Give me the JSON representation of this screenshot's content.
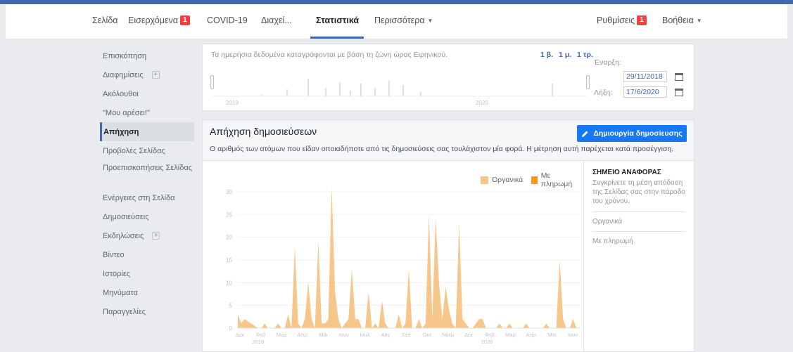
{
  "nav": {
    "page": "Σελίδα",
    "inbox": "Εισερχόμενα",
    "inbox_badge": "1",
    "covid": "COVID-19",
    "manage": "Διαχεί...",
    "insights": "Στατιστικά",
    "more": "Περισσότερα",
    "settings": "Ρυθμίσεις",
    "settings_badge": "1",
    "help": "Βοήθεια"
  },
  "sidebar": {
    "items": [
      {
        "label": "Επισκόπηση"
      },
      {
        "label": "Διαφημίσεις"
      },
      {
        "label": "Ακόλουθοι"
      },
      {
        "label": "\"Μου αρέσει!\""
      },
      {
        "label": "Απήχηση"
      },
      {
        "label": "Προβολές Σελίδας"
      },
      {
        "label": "Προεπισκοπήσεις Σελίδας"
      },
      {
        "label": "Ενέργειες στη Σελίδα"
      },
      {
        "label": "Δημοσιεύσεις"
      },
      {
        "label": "Εκδηλώσεις"
      },
      {
        "label": "Βίντεο"
      },
      {
        "label": "Ιστορίες"
      },
      {
        "label": "Μηνύματα"
      },
      {
        "label": "Παραγγελίες"
      }
    ]
  },
  "range": {
    "tz_note": "Τα ημερήσια δεδομένα καταγράφονται με βάση τη ζώνη ώρας Ειρηνικού.",
    "d1": "1 β.",
    "m1": "1 μ.",
    "q1": "1 τρ.",
    "start_label": "Έναρξη:",
    "start_value": "29/11/2018",
    "end_label": "Λήξη:",
    "end_value": "17/6/2020",
    "mini_year1": "2019",
    "mini_year2": "2020"
  },
  "main": {
    "title": "Απήχηση δημοσιεύσεων",
    "description": "Ο αριθμός των ατόμων που είδαν οποιαδήποτε από τις δημοσιεύσεις σας τουλάχιστον μία φορά. Η μέτρηση αυτή παρέχεται κατά προσέγγιση.",
    "create_button": "Δημιουργία δημοσίευσης"
  },
  "reference": {
    "title": "ΣΗΜΕΙΟ ΑΝΑΦΟΡΑΣ",
    "description": "Συγκρίνετε τη μέση απόδοση της Σελίδας σας στην πάροδο του χρόνου.",
    "organic": "Οργανικά",
    "paid": "Με πληρωμή"
  },
  "chart_data": {
    "type": "area",
    "series": [
      {
        "name": "Οργανικά",
        "color": "#f7c68a"
      },
      {
        "name": "Με πληρωμή",
        "color": "#f39c12"
      }
    ],
    "ylim": [
      0,
      32
    ],
    "yticks": [
      "0",
      "5",
      "10",
      "15",
      "20",
      "25",
      "30"
    ],
    "xticks": [
      "Δεκ",
      "Φεβ",
      "Μαρ",
      "Απρ",
      "Μάι",
      "Ιουν",
      "Ιουλ",
      "Αυγ",
      "Σεπ",
      "Οκτ",
      "Νοεμ",
      "Δεκ",
      "Φεβ",
      "Μαρ",
      "Απρ",
      "Μάι",
      "Ιουν"
    ],
    "years": [
      "2019",
      "2020"
    ],
    "organic_values": [
      3,
      1,
      2,
      1.5,
      1,
      0.5,
      0,
      0,
      1,
      0,
      0,
      0,
      1,
      0,
      0,
      3,
      0,
      18,
      1,
      0,
      2,
      10,
      2,
      0,
      19,
      1,
      1,
      2,
      31,
      8,
      2,
      0,
      1,
      2,
      13,
      2,
      2,
      0,
      0,
      8,
      0,
      1,
      0,
      6,
      1,
      0,
      0,
      0,
      3,
      0,
      1,
      13,
      0,
      0,
      2,
      0,
      1,
      25,
      2,
      24,
      10,
      2,
      9,
      4,
      1,
      0,
      23,
      2,
      1,
      0,
      0,
      1,
      2,
      2,
      0,
      0,
      0,
      0,
      1,
      0,
      0,
      1,
      0,
      0,
      0,
      0,
      1,
      0,
      0,
      0,
      0,
      0,
      1,
      0,
      0,
      0,
      15,
      2,
      0,
      0,
      2,
      0,
      0
    ],
    "paid_values": []
  }
}
